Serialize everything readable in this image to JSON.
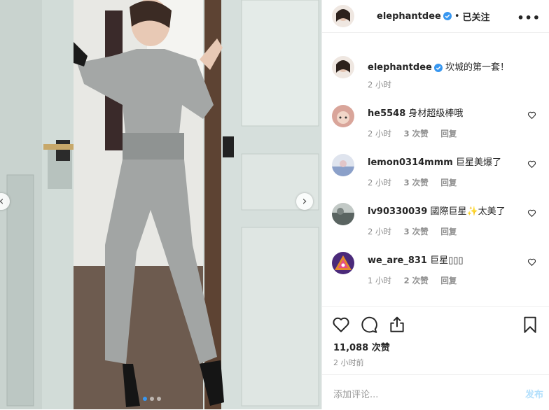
{
  "header": {
    "username": "elephantdee",
    "separator": "•",
    "follow_label": "已关注",
    "more_label": "•••"
  },
  "caption": {
    "username": "elephantdee",
    "text": "坎城的第一套！",
    "time": "2 小时"
  },
  "comments": [
    {
      "user": "he5548",
      "text": "身材超级棒哦",
      "time": "2 小时",
      "likes": "3 次赞",
      "reply": "回复",
      "avatar_color": "#d9a59a"
    },
    {
      "user": "lemon0314mmm",
      "text": "巨星美爆了",
      "time": "2 小时",
      "likes": "3 次赞",
      "reply": "回复",
      "avatar_color": "#b9c3dc"
    },
    {
      "user": "lv90330039",
      "text": "國際巨星✨太美了",
      "time": "2 小时",
      "likes": "3 次赞",
      "reply": "回复",
      "avatar_color": "#6f7d7a"
    },
    {
      "user": "we_are_831",
      "text": "巨星▯▯▯",
      "time": "1 小时",
      "likes": "2 次赞",
      "reply": "回复",
      "avatar_color": "#5b2d8a"
    }
  ],
  "stats": {
    "likes": "11,088 次赞",
    "time_ago": "2 小时前"
  },
  "add_comment": {
    "placeholder": "添加评论...",
    "post_label": "发布"
  },
  "icons": [
    "heart-icon",
    "comment-icon",
    "share-icon",
    "bookmark-icon",
    "verified-icon",
    "chevron-right-icon",
    "chevron-left-icon"
  ],
  "colors": {
    "verified": "#3897f0",
    "post_disabled": "#b2dffc",
    "muted": "#8e8e8e",
    "text": "#262626"
  }
}
